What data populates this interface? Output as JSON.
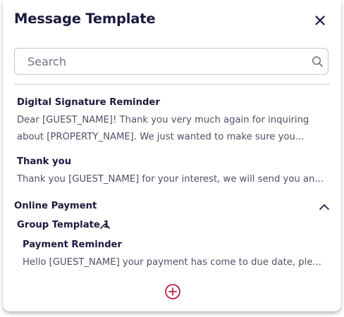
{
  "panel": {
    "title": "Message Template",
    "close_icon": "close-icon"
  },
  "search": {
    "placeholder": "Search",
    "value": "",
    "icon": "search-icon"
  },
  "templates": [
    {
      "title": "Digital Signature Reminder",
      "line1": "Dear [GUEST_NAME]! Thank you very much again for inquiring",
      "line2": "about [PROPERTY_NAME]. We just wanted to make sure you..."
    },
    {
      "title": "Thank you",
      "line1": "Thank you [GUEST_NAME] for your interest, we will send you an..."
    }
  ],
  "categories": [
    {
      "name": "Online Payment",
      "expanded": true,
      "groups": [
        {
          "name": "Group Template 1",
          "expanded": true,
          "templates": [
            {
              "title": "Payment Reminder",
              "preview": "Hello [GUEST_NAME] your payment has come to due date, ple..."
            }
          ]
        }
      ]
    }
  ],
  "add_icon": "add-circle-icon",
  "colors": {
    "heading": "#1b1a3d",
    "body_text": "#4d5264",
    "accent": "#b0263f",
    "border": "#c5c7cf"
  }
}
